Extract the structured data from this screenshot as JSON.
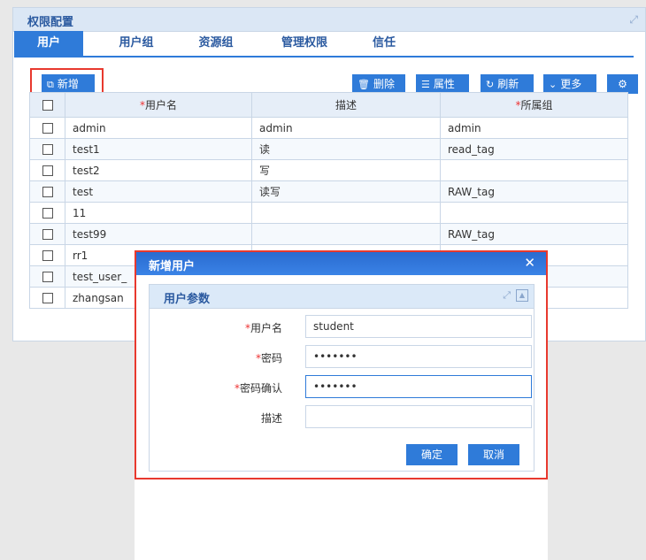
{
  "panel": {
    "title": "权限配置"
  },
  "tabs": [
    "用户",
    "用户组",
    "资源组",
    "管理权限",
    "信任"
  ],
  "toolbar": {
    "add": "新增",
    "delete": "删除",
    "properties": "属性",
    "refresh": "刷新",
    "more": "更多"
  },
  "table": {
    "headers": [
      "用户名",
      "描述",
      "所属组"
    ],
    "rows": [
      [
        "admin",
        "admin",
        "admin"
      ],
      [
        "test1",
        "读",
        "read_tag"
      ],
      [
        "test2",
        "写",
        ""
      ],
      [
        "test",
        "读写",
        "RAW_tag"
      ],
      [
        "11",
        "",
        ""
      ],
      [
        "test99",
        "",
        "RAW_tag"
      ],
      [
        "rr1",
        "",
        ""
      ],
      [
        "test_user_",
        "",
        ""
      ],
      [
        "zhangsan",
        "",
        ""
      ]
    ]
  },
  "dialog": {
    "title": "新增用户",
    "section": "用户参数",
    "fields": {
      "username": {
        "label": "用户名",
        "value": "student"
      },
      "password": {
        "label": "密码",
        "value": "•••••••"
      },
      "confirm": {
        "label": "密码确认",
        "value": "•••••••"
      },
      "desc": {
        "label": "描述",
        "value": ""
      }
    },
    "ok": "确定",
    "cancel": "取消"
  }
}
